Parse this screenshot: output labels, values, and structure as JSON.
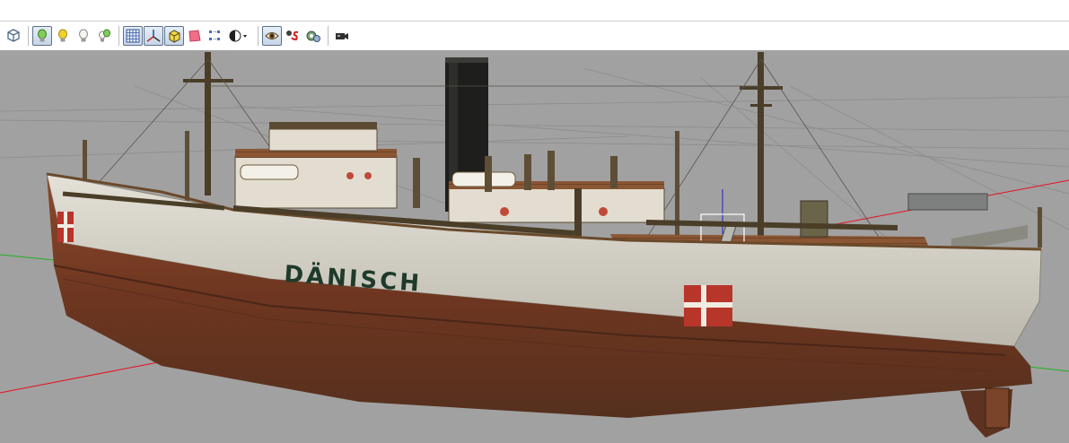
{
  "app": {
    "toolbar": {
      "buttons": [
        {
          "id": "view-cube",
          "icon": "cube-wireframe-icon",
          "pressed": false
        },
        {
          "id": "lighting",
          "icon": "lightbulb-green-icon",
          "pressed": true
        },
        {
          "id": "light-yellow",
          "icon": "lightbulb-yellow-icon",
          "pressed": false
        },
        {
          "id": "light-off",
          "icon": "lightbulb-white-icon",
          "pressed": false
        },
        {
          "id": "light-multi",
          "icon": "lightbulb-multi-icon",
          "pressed": false
        },
        {
          "id": "grid",
          "icon": "grid-icon",
          "pressed": true
        },
        {
          "id": "axes",
          "icon": "axes-icon",
          "pressed": true
        },
        {
          "id": "bounding-box",
          "icon": "box-yellow-icon",
          "pressed": true
        },
        {
          "id": "ground-plane",
          "icon": "pink-plane-icon",
          "pressed": false
        },
        {
          "id": "vertex-numbers",
          "icon": "vertex-numbers-icon",
          "pressed": false
        },
        {
          "id": "shading",
          "icon": "shading-sphere-icon",
          "pressed": false
        },
        {
          "id": "eye",
          "icon": "eye-icon",
          "pressed": true
        },
        {
          "id": "sound",
          "icon": "glasses-s-icon",
          "pressed": false
        },
        {
          "id": "animation",
          "icon": "gears-icon",
          "pressed": false
        },
        {
          "id": "camera",
          "icon": "camera-icon",
          "pressed": false
        }
      ]
    },
    "viewport": {
      "background": "#a1a1a1",
      "hull_text": "DÄNISCH",
      "colors": {
        "axis_red": "#e8111a",
        "axis_green": "#1fb01f",
        "axis_blue": "#2020d8",
        "hull_white": "#d8d5cc",
        "hull_rust": "#7a3b22",
        "deck_wood": "#8a5634",
        "flag_red": "#b8352a"
      }
    }
  }
}
